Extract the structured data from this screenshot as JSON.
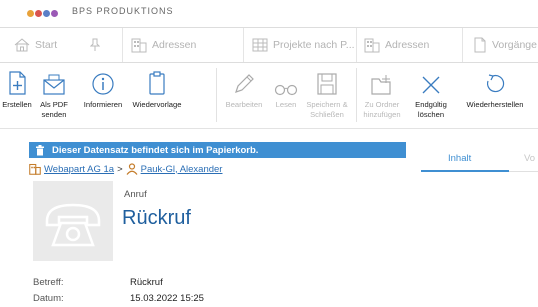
{
  "brand": {
    "name": "BPS PRODUKTIONS",
    "colors": [
      "#e8a23a",
      "#d9534f",
      "#5b7fc7",
      "#9b59b6"
    ]
  },
  "tabs": [
    {
      "label": "Start",
      "icon": "home-icon"
    },
    {
      "label": "",
      "icon": "pin-icon"
    },
    {
      "label": "Adressen",
      "icon": "building-icon"
    },
    {
      "label": "Projekte nach P...",
      "icon": "table-icon"
    },
    {
      "label": "Adressen",
      "icon": "building-icon"
    },
    {
      "label": "Vorgänge",
      "icon": "document-icon"
    }
  ],
  "ribbon": [
    {
      "label": "Erstellen",
      "icon": "create-document-icon",
      "enabled": true
    },
    {
      "label": "Als PDF senden",
      "icon": "pdf-mail-icon",
      "enabled": true
    },
    {
      "label": "Informieren",
      "icon": "info-icon",
      "enabled": true
    },
    {
      "label": "Wiedervorlage",
      "icon": "clipboard-icon",
      "enabled": true
    },
    {
      "label": "Bearbeiten",
      "icon": "pencil-icon",
      "enabled": false
    },
    {
      "label": "Lesen",
      "icon": "glasses-icon",
      "enabled": false
    },
    {
      "label": "Speichern & Schließen",
      "icon": "save-icon",
      "enabled": false
    },
    {
      "label": "Zu Ordner hinzufügen",
      "icon": "folder-add-icon",
      "enabled": false
    },
    {
      "label": "Endgültig löschen",
      "icon": "delete-x-icon",
      "enabled": true
    },
    {
      "label": "Wiederherstellen",
      "icon": "restore-icon",
      "enabled": true
    }
  ],
  "banner": {
    "text": "Dieser Datensatz befindet sich im Papierkorb.",
    "color": "#3f8fd2"
  },
  "breadcrumb": {
    "company": "Webapart AG 1a",
    "separator": ">",
    "person": "Pauk-Gl, Alexander"
  },
  "panel_tabs": {
    "active": "Inhalt",
    "next": "Vo"
  },
  "record": {
    "type": "Anruf",
    "title": "Rückruf"
  },
  "fields": [
    {
      "label": "Betreff:",
      "value": "Rückruf"
    },
    {
      "label": "Datum:",
      "value": "15.03.2022 15:25"
    }
  ]
}
